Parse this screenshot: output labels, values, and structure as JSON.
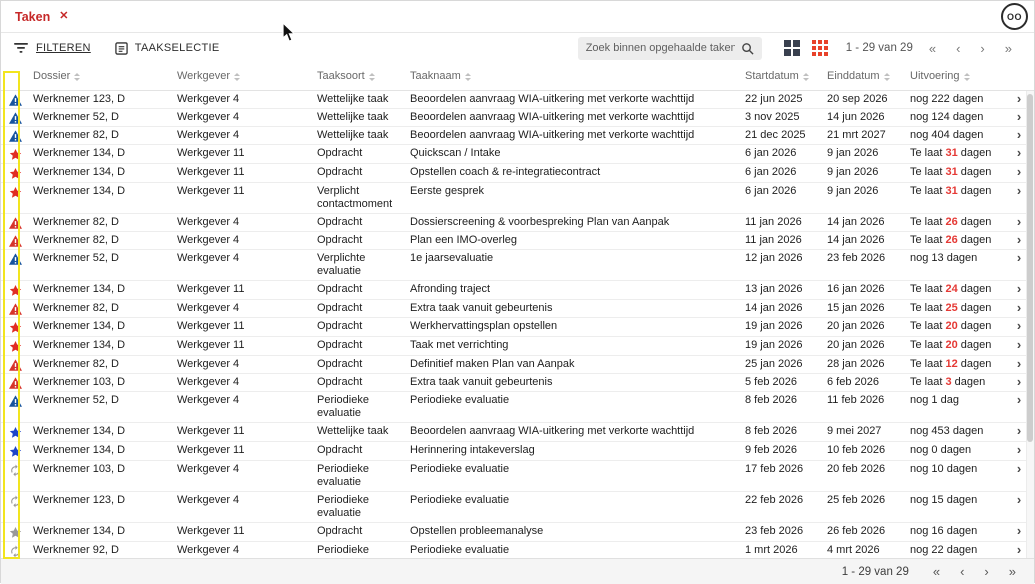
{
  "colors": {
    "tab_red": "#c62828",
    "icon_blue": "#17549e",
    "icon_red": "#d6342b",
    "icon_star_red": "#e02d24",
    "icon_star_blue": "#1e46c8",
    "icon_gray": "#999999",
    "late_num_red": "#e53935",
    "active_view_red": "#e8422a",
    "highlight_yellow": "#f2e51e"
  },
  "icons": {
    "tab_close": "✕",
    "row_chevron": "›"
  },
  "tab": {
    "title": "Taken",
    "close_glyph": "✕"
  },
  "topbar": {
    "avatar_label": "OO"
  },
  "toolbar": {
    "filter_label": "FILTEREN",
    "task_select_label": "TAAKSELECTIE",
    "search_placeholder": "Zoek binnen opgehaalde taken",
    "range_label": "1 - 29 van 29",
    "pager": {
      "first": "«",
      "prev": "‹",
      "next": "›",
      "last": "»"
    }
  },
  "table": {
    "columns": [
      "Dossier",
      "Werkgever",
      "Taaksoort",
      "Taaknaam",
      "Startdatum",
      "Einddatum",
      "Uitvoering"
    ],
    "rows": [
      {
        "icon": "warning-blue",
        "dossier": "Werknemer 123, D",
        "werkgever": "Werkgever 4",
        "taaksoort": "Wettelijke taak",
        "taaknaam": "Beoordelen aanvraag WIA-uitkering met verkorte wachttijd",
        "start": "22 jun 2025",
        "eind": "20 sep 2026",
        "uitvoering": {
          "pre": "nog 222 dagen",
          "num": "",
          "post": ""
        }
      },
      {
        "icon": "warning-blue",
        "dossier": "Werknemer 52, D",
        "werkgever": "Werkgever 4",
        "taaksoort": "Wettelijke taak",
        "taaknaam": "Beoordelen aanvraag WIA-uitkering met verkorte wachttijd",
        "start": "3 nov 2025",
        "eind": "14 jun 2026",
        "uitvoering": {
          "pre": "nog 124 dagen",
          "num": "",
          "post": ""
        }
      },
      {
        "icon": "warning-blue",
        "dossier": "Werknemer 82, D",
        "werkgever": "Werkgever 4",
        "taaksoort": "Wettelijke taak",
        "taaknaam": "Beoordelen aanvraag WIA-uitkering met verkorte wachttijd",
        "start": "21 dec 2025",
        "eind": "21 mrt 2027",
        "uitvoering": {
          "pre": "nog 404 dagen",
          "num": "",
          "post": ""
        }
      },
      {
        "icon": "star-red",
        "dossier": "Werknemer 134, D",
        "werkgever": "Werkgever 11",
        "taaksoort": "Opdracht",
        "taaknaam": "Quickscan / Intake",
        "start": "6 jan 2026",
        "eind": "9 jan 2026",
        "uitvoering": {
          "pre": "Te laat ",
          "num": "31",
          "post": " dagen"
        }
      },
      {
        "icon": "star-red",
        "dossier": "Werknemer 134, D",
        "werkgever": "Werkgever 11",
        "taaksoort": "Opdracht",
        "taaknaam": "Opstellen coach & re-integratiecontract",
        "start": "6 jan 2026",
        "eind": "9 jan 2026",
        "uitvoering": {
          "pre": "Te laat ",
          "num": "31",
          "post": " dagen"
        }
      },
      {
        "icon": "star-red",
        "dossier": "Werknemer 134, D",
        "werkgever": "Werkgever 11",
        "taaksoort": "Verplicht contactmoment",
        "taaknaam": "Eerste gesprek",
        "start": "6 jan 2026",
        "eind": "9 jan 2026",
        "uitvoering": {
          "pre": "Te laat ",
          "num": "31",
          "post": " dagen"
        }
      },
      {
        "icon": "warning-red",
        "dossier": "Werknemer 82, D",
        "werkgever": "Werkgever 4",
        "taaksoort": "Opdracht",
        "taaknaam": "Dossierscreening & voorbespreking Plan van Aanpak",
        "start": "11 jan 2026",
        "eind": "14 jan 2026",
        "uitvoering": {
          "pre": "Te laat ",
          "num": "26",
          "post": " dagen"
        }
      },
      {
        "icon": "warning-red",
        "dossier": "Werknemer 82, D",
        "werkgever": "Werkgever 4",
        "taaksoort": "Opdracht",
        "taaknaam": "Plan een IMO-overleg",
        "start": "11 jan 2026",
        "eind": "14 jan 2026",
        "uitvoering": {
          "pre": "Te laat ",
          "num": "26",
          "post": " dagen"
        }
      },
      {
        "icon": "warning-blue",
        "dossier": "Werknemer 52, D",
        "werkgever": "Werkgever 4",
        "taaksoort": "Verplichte evaluatie",
        "taaknaam": "1e jaarsevaluatie",
        "start": "12 jan 2026",
        "eind": "23 feb 2026",
        "uitvoering": {
          "pre": "nog 13 dagen",
          "num": "",
          "post": ""
        }
      },
      {
        "icon": "star-red",
        "dossier": "Werknemer 134, D",
        "werkgever": "Werkgever 11",
        "taaksoort": "Opdracht",
        "taaknaam": "Afronding traject",
        "start": "13 jan 2026",
        "eind": "16 jan 2026",
        "uitvoering": {
          "pre": "Te laat ",
          "num": "24",
          "post": " dagen"
        }
      },
      {
        "icon": "warning-red",
        "dossier": "Werknemer 82, D",
        "werkgever": "Werkgever 4",
        "taaksoort": "Opdracht",
        "taaknaam": "Extra taak vanuit gebeurtenis",
        "start": "14 jan 2026",
        "eind": "15 jan 2026",
        "uitvoering": {
          "pre": "Te laat ",
          "num": "25",
          "post": " dagen"
        }
      },
      {
        "icon": "star-red",
        "dossier": "Werknemer 134, D",
        "werkgever": "Werkgever 11",
        "taaksoort": "Opdracht",
        "taaknaam": "Werkhervattingsplan opstellen",
        "start": "19 jan 2026",
        "eind": "20 jan 2026",
        "uitvoering": {
          "pre": "Te laat ",
          "num": "20",
          "post": " dagen"
        }
      },
      {
        "icon": "star-red",
        "dossier": "Werknemer 134, D",
        "werkgever": "Werkgever 11",
        "taaksoort": "Opdracht",
        "taaknaam": "Taak met verrichting",
        "start": "19 jan 2026",
        "eind": "20 jan 2026",
        "uitvoering": {
          "pre": "Te laat ",
          "num": "20",
          "post": " dagen"
        }
      },
      {
        "icon": "warning-red",
        "dossier": "Werknemer 82, D",
        "werkgever": "Werkgever 4",
        "taaksoort": "Opdracht",
        "taaknaam": "Definitief maken Plan van Aanpak",
        "start": "25 jan 2026",
        "eind": "28 jan 2026",
        "uitvoering": {
          "pre": "Te laat ",
          "num": "12",
          "post": " dagen"
        }
      },
      {
        "icon": "warning-red",
        "dossier": "Werknemer 103, D",
        "werkgever": "Werkgever 4",
        "taaksoort": "Opdracht",
        "taaknaam": "Extra taak vanuit gebeurtenis",
        "start": "5 feb 2026",
        "eind": "6 feb 2026",
        "uitvoering": {
          "pre": "Te laat ",
          "num": "3",
          "post": " dagen"
        }
      },
      {
        "icon": "warning-blue",
        "dossier": "Werknemer 52, D",
        "werkgever": "Werkgever 4",
        "taaksoort": "Periodieke evaluatie",
        "taaknaam": "Periodieke evaluatie",
        "start": "8 feb 2026",
        "eind": "11 feb 2026",
        "uitvoering": {
          "pre": "nog 1 dag",
          "num": "",
          "post": ""
        }
      },
      {
        "icon": "star-blue",
        "dossier": "Werknemer 134, D",
        "werkgever": "Werkgever 11",
        "taaksoort": "Wettelijke taak",
        "taaknaam": "Beoordelen aanvraag WIA-uitkering met verkorte wachttijd",
        "start": "8 feb 2026",
        "eind": "9 mei 2027",
        "uitvoering": {
          "pre": "nog 453 dagen",
          "num": "",
          "post": ""
        }
      },
      {
        "icon": "star-blue",
        "dossier": "Werknemer 134, D",
        "werkgever": "Werkgever 11",
        "taaksoort": "Opdracht",
        "taaknaam": "Herinnering intakeverslag",
        "start": "9 feb 2026",
        "eind": "10 feb 2026",
        "uitvoering": {
          "pre": "nog 0 dagen",
          "num": "",
          "post": ""
        }
      },
      {
        "icon": "sync-gray",
        "dossier": "Werknemer 103, D",
        "werkgever": "Werkgever 4",
        "taaksoort": "Periodieke evaluatie",
        "taaknaam": "Periodieke evaluatie",
        "start": "17 feb 2026",
        "eind": "20 feb 2026",
        "uitvoering": {
          "pre": "nog 10 dagen",
          "num": "",
          "post": ""
        }
      },
      {
        "icon": "sync-gray",
        "dossier": "Werknemer 123, D",
        "werkgever": "Werkgever 4",
        "taaksoort": "Periodieke evaluatie",
        "taaknaam": "Periodieke evaluatie",
        "start": "22 feb 2026",
        "eind": "25 feb 2026",
        "uitvoering": {
          "pre": "nog 15 dagen",
          "num": "",
          "post": ""
        }
      },
      {
        "icon": "star-gray",
        "dossier": "Werknemer 134, D",
        "werkgever": "Werkgever 11",
        "taaksoort": "Opdracht",
        "taaknaam": "Opstellen probleemanalyse",
        "start": "23 feb 2026",
        "eind": "26 feb 2026",
        "uitvoering": {
          "pre": "nog 16 dagen",
          "num": "",
          "post": ""
        }
      },
      {
        "icon": "sync-gray",
        "dossier": "Werknemer 92, D",
        "werkgever": "Werkgever 4",
        "taaksoort": "Periodieke evaluatie",
        "taaknaam": "Periodieke evaluatie",
        "start": "1 mrt 2026",
        "eind": "4 mrt 2026",
        "uitvoering": {
          "pre": "nog 22 dagen",
          "num": "",
          "post": ""
        }
      }
    ]
  },
  "footer": {
    "range_label": "1 - 29 van 29",
    "pager": {
      "first": "«",
      "prev": "‹",
      "next": "›",
      "last": "»"
    }
  }
}
